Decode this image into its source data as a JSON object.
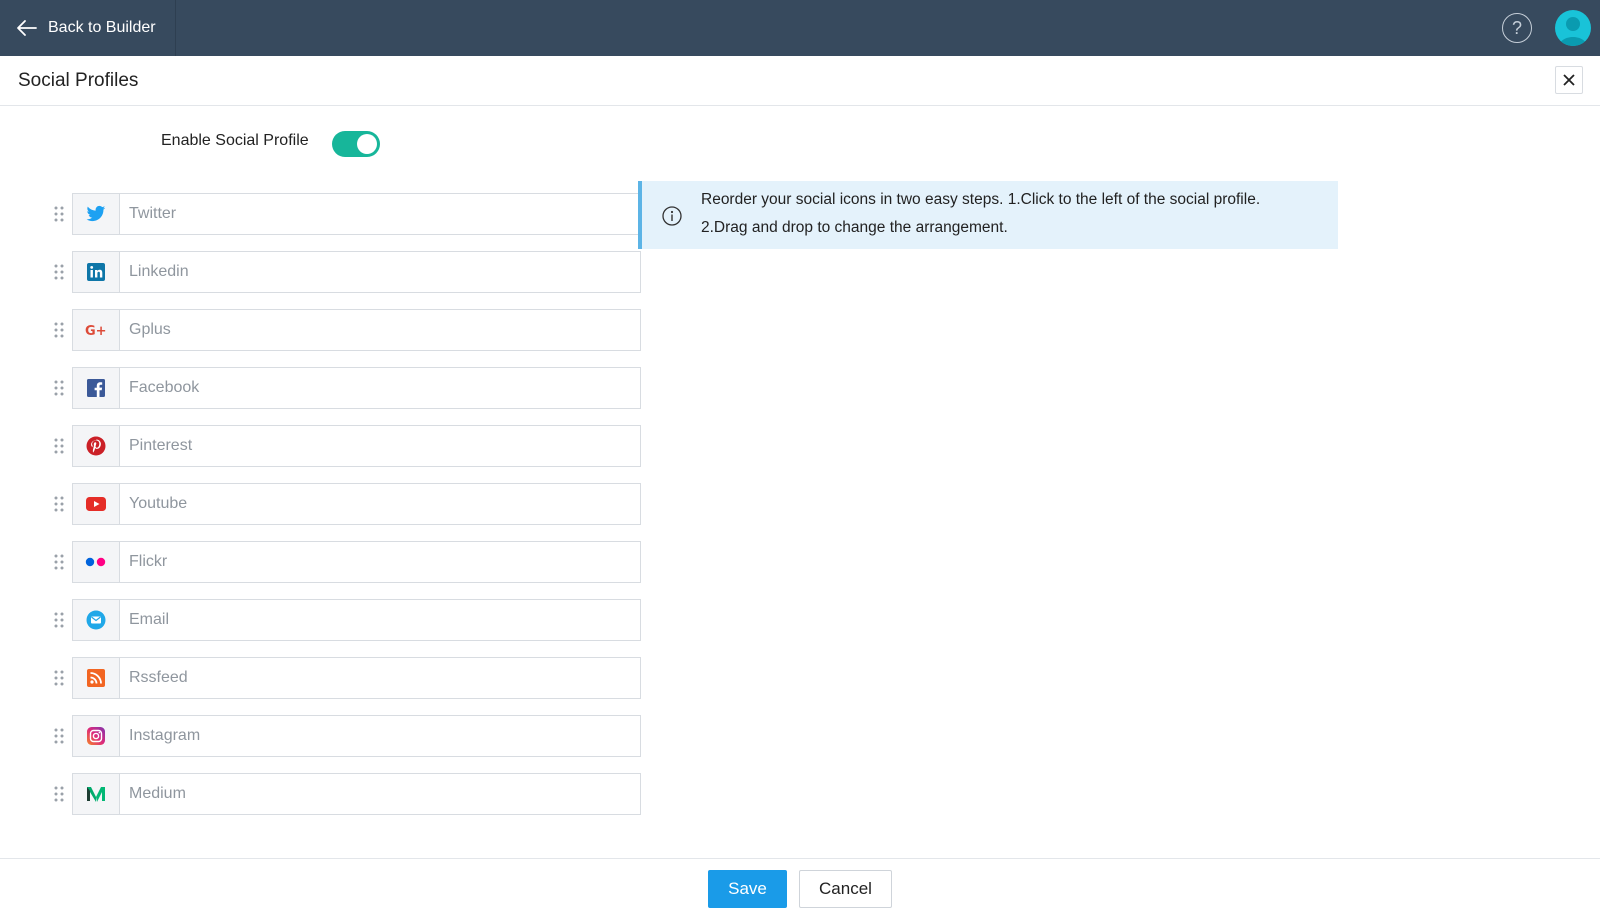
{
  "topbar": {
    "back_label": "Back to Builder",
    "help_glyph": "?",
    "background": "#374a5e",
    "avatar_color": "#19c3d8"
  },
  "header": {
    "title": "Social Profiles"
  },
  "enable": {
    "label": "Enable Social Profile",
    "enabled": true,
    "toggle_color": "#17b69a"
  },
  "profiles": [
    {
      "name": "twitter",
      "placeholder": "Twitter",
      "icon": "twitter-icon",
      "color": "#1da1f2"
    },
    {
      "name": "linkedin",
      "placeholder": "Linkedin",
      "icon": "linkedin-icon",
      "color": "#0e76a8"
    },
    {
      "name": "gplus",
      "placeholder": "Gplus",
      "icon": "google-plus-icon",
      "color": "#dd4b39"
    },
    {
      "name": "facebook",
      "placeholder": "Facebook",
      "icon": "facebook-icon",
      "color": "#3b5998"
    },
    {
      "name": "pinterest",
      "placeholder": "Pinterest",
      "icon": "pinterest-icon",
      "color": "#cb2027"
    },
    {
      "name": "youtube",
      "placeholder": "Youtube",
      "icon": "youtube-icon",
      "color": "#e52d27"
    },
    {
      "name": "flickr",
      "placeholder": "Flickr",
      "icon": "flickr-icon",
      "color": "#0063dc"
    },
    {
      "name": "email",
      "placeholder": "Email",
      "icon": "email-icon",
      "color": "#20a8e8"
    },
    {
      "name": "rssfeed",
      "placeholder": "Rssfeed",
      "icon": "rss-icon",
      "color": "#f26522"
    },
    {
      "name": "instagram",
      "placeholder": "Instagram",
      "icon": "instagram-icon",
      "color": "#c13584"
    },
    {
      "name": "medium",
      "placeholder": "Medium",
      "icon": "medium-icon",
      "color": "#02b875"
    }
  ],
  "info": {
    "line1": "Reorder your social icons in two easy steps. 1.Click to the left of the social profile.",
    "line2": "2.Drag and drop to change the arrangement.",
    "background": "#e4f2fb",
    "border_color": "#5cb4e6"
  },
  "footer": {
    "save_label": "Save",
    "cancel_label": "Cancel",
    "save_color": "#1a9be8"
  }
}
